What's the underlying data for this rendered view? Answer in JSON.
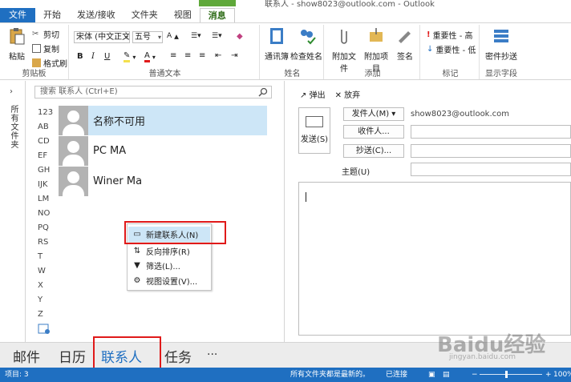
{
  "window": {
    "title_fragment": "联系人 - show8023@outlook.com - Outlook"
  },
  "tabs": [
    {
      "label": "文件"
    },
    {
      "label": "开始"
    },
    {
      "label": "发送/接收"
    },
    {
      "label": "文件夹"
    },
    {
      "label": "视图"
    },
    {
      "label": "消息"
    }
  ],
  "ribbon": {
    "clipboard": {
      "paste": "粘贴",
      "cut": "剪切",
      "copy": "复制",
      "format_painter": "格式刷",
      "group": "剪贴板"
    },
    "text": {
      "font": "宋体 (中文正文",
      "size": "五号",
      "bold": "B",
      "italic": "I",
      "underline": "U",
      "group": "普通文本"
    },
    "names": {
      "address_book": "通讯簿",
      "check_names": "检查姓名",
      "group": "姓名"
    },
    "include": {
      "attach_file": "附加文件",
      "attach_item": "附加项目",
      "signature": "签名",
      "group": "添加"
    },
    "tags": {
      "high": "重要性 - 高",
      "low": "重要性 - 低",
      "group": "标记"
    },
    "fields": {
      "bcc": "密件抄送",
      "group": "显示字段"
    }
  },
  "folder_pane": {
    "label": "所有文件夹"
  },
  "list": {
    "search_placeholder": "搜索 联系人 (Ctrl+E)",
    "alpha_index": [
      "123",
      "AB",
      "CD",
      "EF",
      "GH",
      "IJK",
      "LM",
      "NO",
      "PQ",
      "RS",
      "T",
      "W",
      "X",
      "Y",
      "Z"
    ],
    "contacts": [
      {
        "name": "名称不可用"
      },
      {
        "name": "PC MA"
      },
      {
        "name": "Winer Ma"
      }
    ]
  },
  "context_menu": {
    "items": [
      {
        "label": "新建联系人(N)",
        "icon": "contact-card-icon"
      },
      {
        "label": "反向排序(R)",
        "icon": "sort-icon"
      },
      {
        "label": "筛选(L)...",
        "icon": "filter-icon"
      },
      {
        "label": "视图设置(V)...",
        "icon": "settings-icon"
      }
    ]
  },
  "compose": {
    "popout": "弹出",
    "discard": "放弃",
    "send": "发送(S)",
    "from": "发件人(M)",
    "from_address": "show8023@outlook.com",
    "to": "收件人...",
    "cc": "抄送(C)...",
    "subject": "主题(U)"
  },
  "navbar": {
    "mail": "邮件",
    "calendar": "日历",
    "people": "联系人",
    "tasks": "任务",
    "more": "···"
  },
  "statusbar": {
    "items": "项目: 3",
    "folders": "所有文件夹都是最新的。",
    "connected": "已连接",
    "zoom": "100%"
  },
  "watermark": {
    "logo": "Baidu经验",
    "url": "jingyan.baidu.com"
  },
  "colors": {
    "accent": "#1f6fc1",
    "selection": "#cde6f7",
    "annotation": "#e01a1a"
  }
}
